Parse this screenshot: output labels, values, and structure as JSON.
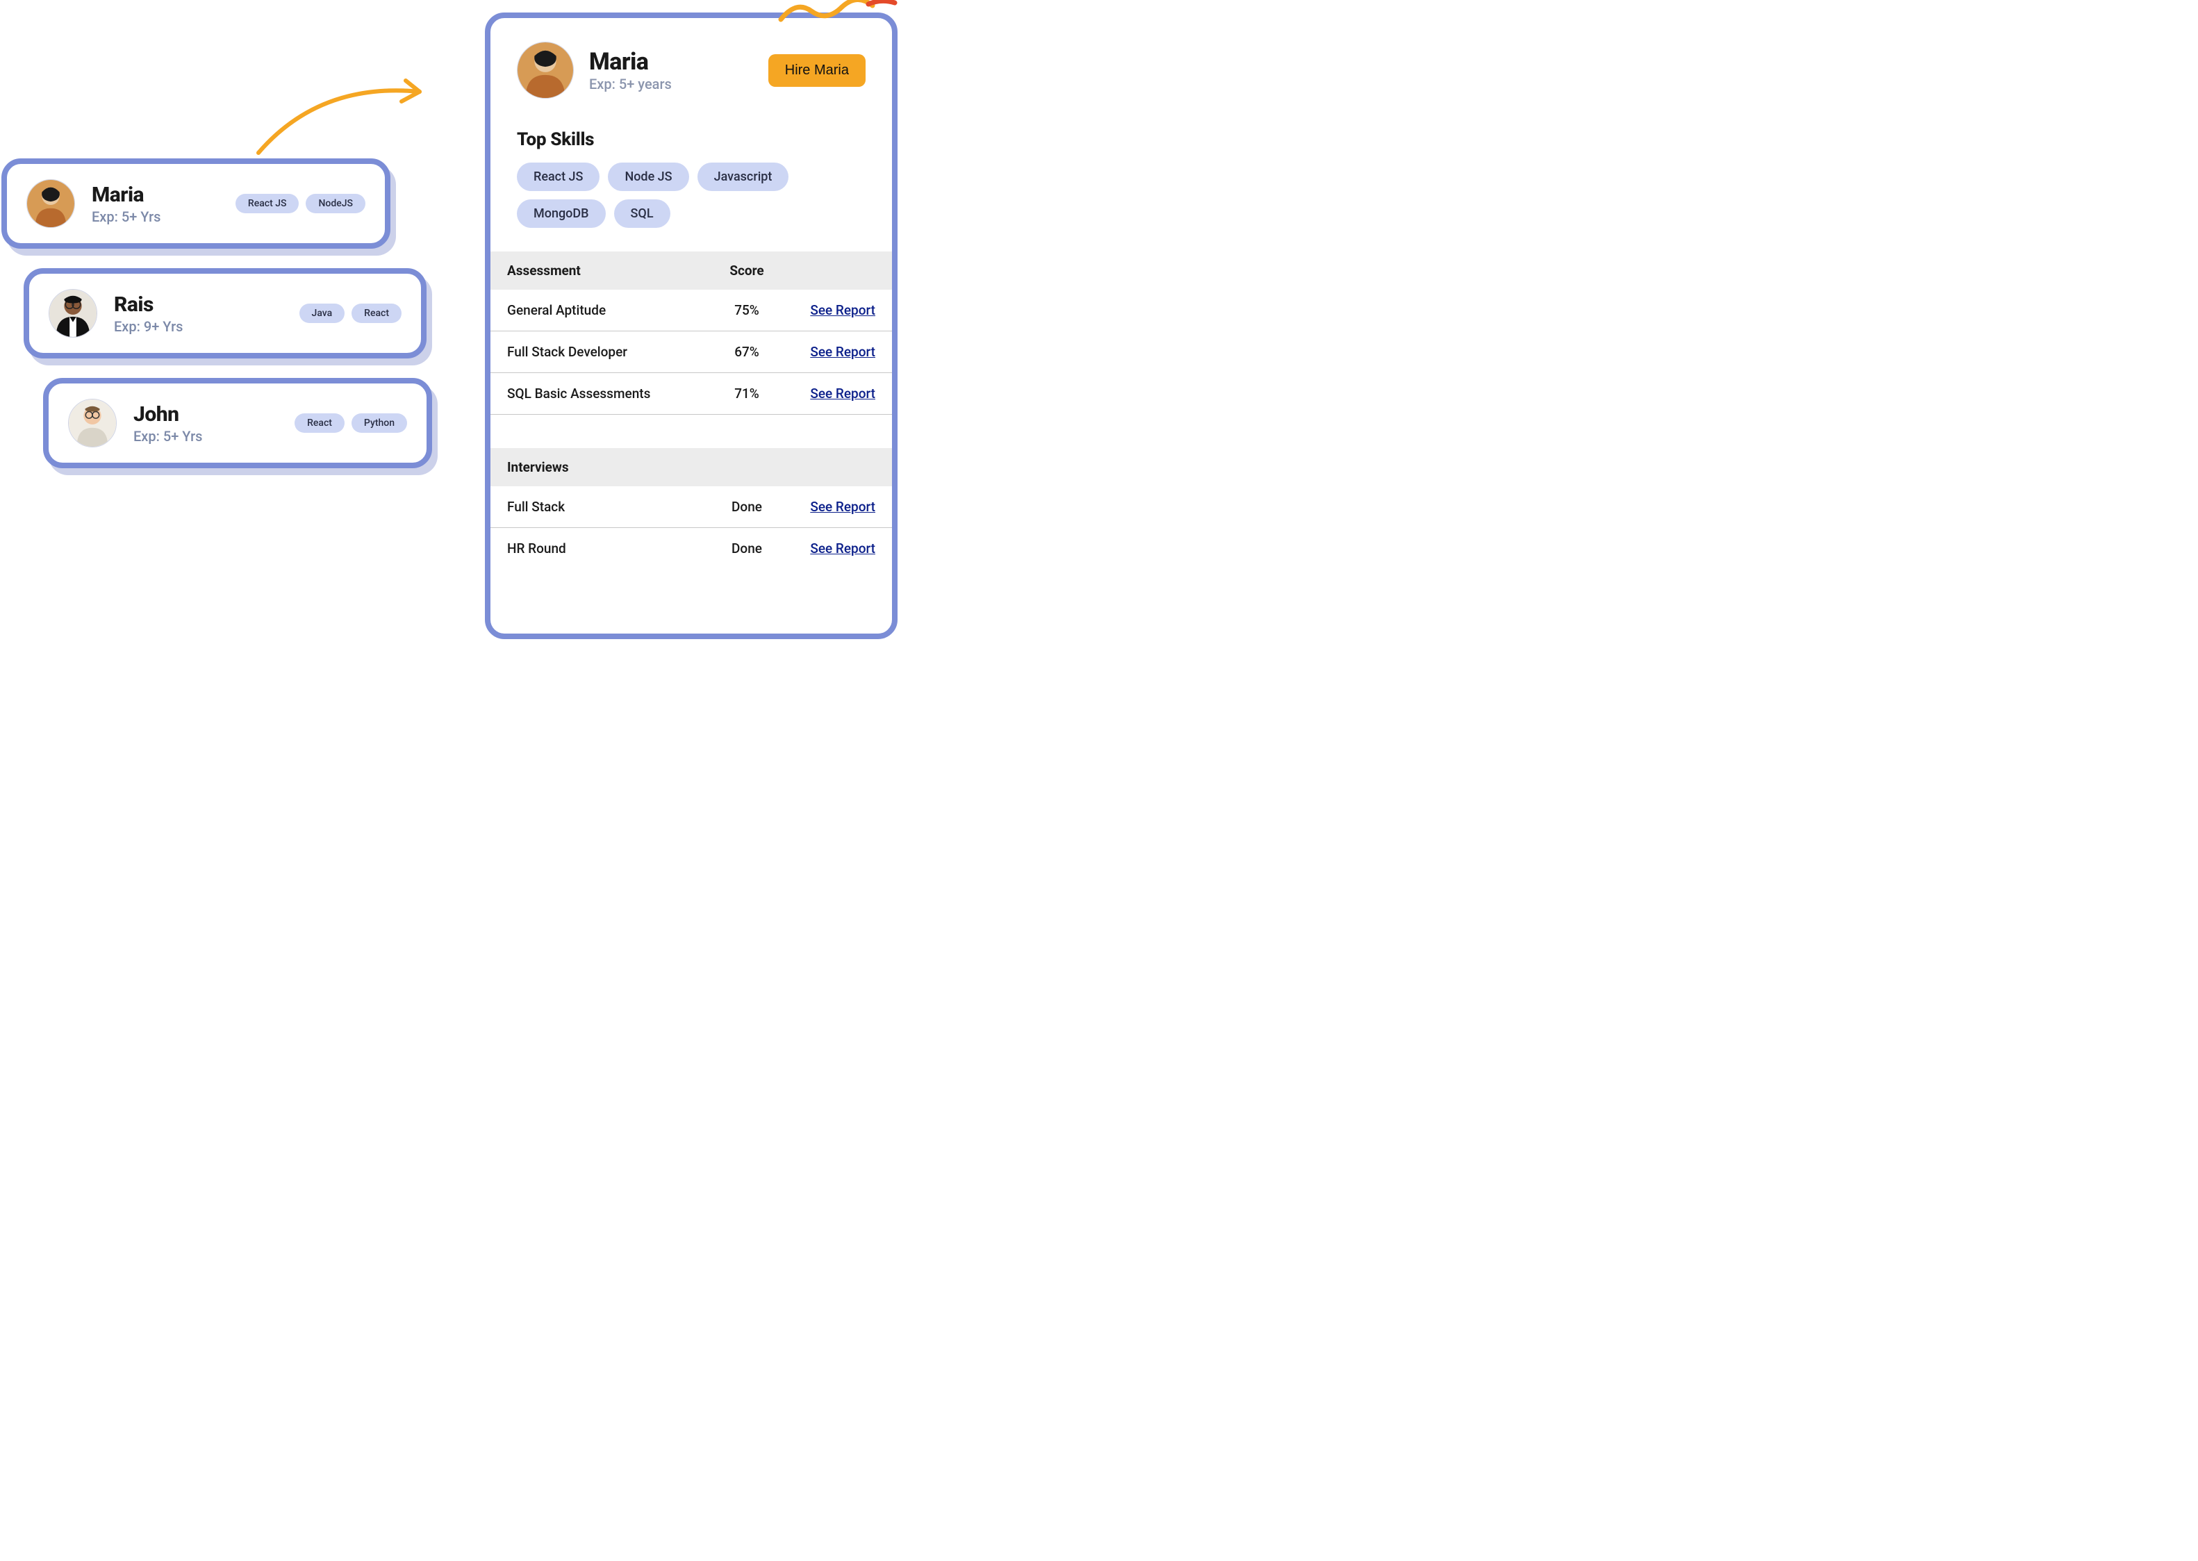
{
  "candidates": [
    {
      "name": "Maria",
      "exp": "Exp: 5+ Yrs",
      "skills": [
        "React JS",
        "NodeJS"
      ],
      "avatar": "maria"
    },
    {
      "name": "Rais",
      "exp": "Exp: 9+ Yrs",
      "skills": [
        "Java",
        "React"
      ],
      "avatar": "rais"
    },
    {
      "name": "John",
      "exp": "Exp: 5+ Yrs",
      "skills": [
        "React",
        "Python"
      ],
      "avatar": "john"
    }
  ],
  "detail": {
    "name": "Maria",
    "exp": "Exp: 5+ years",
    "hire_label": "Hire Maria",
    "top_skills_title": "Top Skills",
    "skills": [
      "React JS",
      "Node JS",
      "Javascript",
      "MongoDB",
      "SQL"
    ],
    "assessment_header": {
      "a": "Assessment",
      "s": "Score"
    },
    "assessments": [
      {
        "name": "General Aptitude",
        "score": "75%",
        "report": "See Report"
      },
      {
        "name": "Full Stack Developer",
        "score": "67%",
        "report": "See Report"
      },
      {
        "name": "SQL Basic Assessments",
        "score": "71%",
        "report": "See Report"
      }
    ],
    "interviews_header": "Interviews",
    "interviews": [
      {
        "name": "Full Stack",
        "status": "Done",
        "report": "See Report"
      },
      {
        "name": "HR Round",
        "status": "Done",
        "report": "See Report"
      }
    ]
  },
  "colors": {
    "card_border": "#7b8dd6",
    "chip_bg": "#cdd6f4",
    "hire_bg": "#f5a623",
    "link": "#0b1f8a",
    "arrow": "#f5a623"
  }
}
